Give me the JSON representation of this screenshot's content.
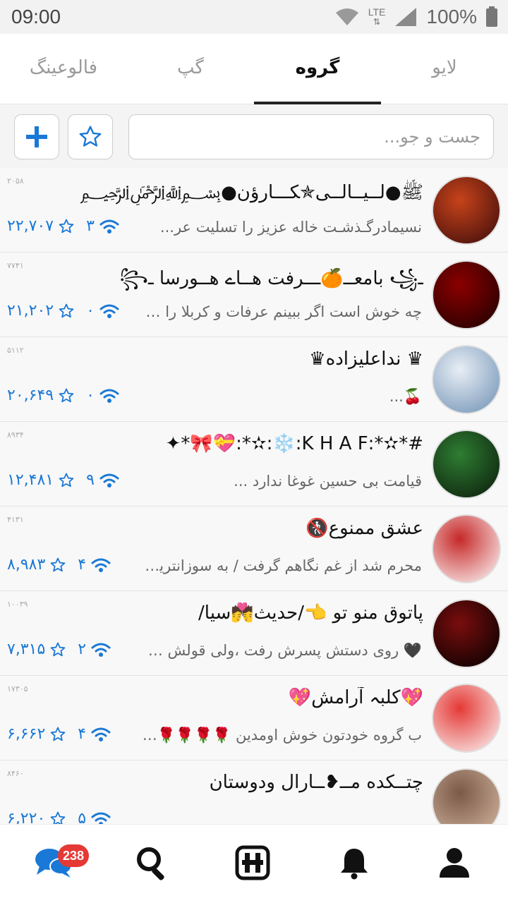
{
  "status_bar": {
    "time": "09:00",
    "network": "LTE",
    "battery": "100%"
  },
  "tabs": [
    {
      "label": "لایو",
      "active": false
    },
    {
      "label": "گروه",
      "active": true
    },
    {
      "label": "گپ",
      "active": false
    },
    {
      "label": "فالوعینگ",
      "active": false
    }
  ],
  "search": {
    "placeholder": "جست و جو..."
  },
  "toolbar": {
    "star_icon": "star-icon",
    "add_icon": "plus-icon"
  },
  "groups": [
    {
      "title": "ﷺ●لــیــالــی✯ﮑـــارؤن●﷽",
      "subtitle": "نسیمادرگـذشـت خاله عزیز را تسلیت عر...",
      "online": "۳",
      "stars": "۲۲,۷۰۷",
      "members": "۲۰۵۸",
      "colors": [
        "#3a0b0b",
        "#c7431a"
      ]
    },
    {
      "title": "ـ꧁ بامعــ🍊ـــرفت هــاے هــورسا ـ꧂",
      "subtitle": "چه خوش است اگر ببینم عرفات و کربلا را حر...",
      "online": "۰",
      "stars": "۲۱,۲۰۲",
      "members": "۷۷۴۱",
      "colors": [
        "#1a0000",
        "#8b0000"
      ]
    },
    {
      "title": "♛ نداعلیزاده♛",
      "subtitle": "🍒...",
      "online": "۰",
      "stars": "۲۰,۶۴۹",
      "members": "۵۱۱۲",
      "colors": [
        "#6d8fb3",
        "#e8eef5"
      ]
    },
    {
      "title": "#*✫*:K H A F:❄️:✫*:💝🎀*✦",
      "subtitle": "قیامت بی حسین غوغا ندارد ...",
      "online": "۹",
      "stars": "۱۲,۴۸۱",
      "members": "۸۹۳۴",
      "colors": [
        "#0b1a0b",
        "#2e7d32"
      ]
    },
    {
      "title": "عشق ممنوع🚷",
      "subtitle": "محرم شد از غم نگاهم گرفت / به سوزانترین ...",
      "online": "۴",
      "stars": "۸,۹۸۳",
      "members": "۴۱۳۱",
      "colors": [
        "#ffffff",
        "#c62828"
      ]
    },
    {
      "title": "پاتوق منو تو 👈/حدیث💏سیا/",
      "subtitle": "🖤 روی دستش پسرش رفت ،ولی قولش ن...",
      "online": "۲",
      "stars": "۷,۳۱۵",
      "members": "۱۰۰۳۹",
      "colors": [
        "#000000",
        "#7a0d0d"
      ]
    },
    {
      "title": "💖کلبہ آرامش💖",
      "subtitle": "ب گروه خودتون خوش اومدین 🌹🌹🌹🌹 ...",
      "online": "۴",
      "stars": "۶,۶۶۲",
      "members": "۱۷۳۰۵",
      "colors": [
        "#fafafa",
        "#e53935"
      ]
    },
    {
      "title": "چتــکده مــ❥ــارال ودوستان",
      "subtitle": "",
      "online": "۵",
      "stars": "۶,۲۲۰",
      "members": "۸۴۶۰",
      "colors": [
        "#d7b9a3",
        "#7a5a48"
      ]
    }
  ],
  "bottom_nav": {
    "messages_badge": "238"
  },
  "colors": {
    "accent": "#1a78d6",
    "badge": "#e53935",
    "active_tab_line": "#222222"
  }
}
